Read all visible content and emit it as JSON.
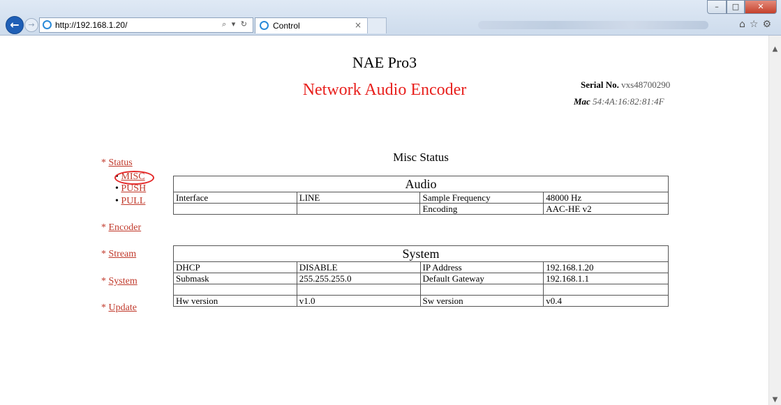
{
  "browser": {
    "url": "http://192.168.1.20/",
    "address_controls": "⌕ ▾ ↻",
    "tab_title": "Control",
    "tab_close": "×"
  },
  "header": {
    "title": "NAE Pro3",
    "subtitle": "Network Audio Encoder",
    "serial_label": "Serial No.",
    "serial_value": "vxs48700290",
    "mac_label": "Mac",
    "mac_value": "54:4A:16:82:81:4F"
  },
  "nav": {
    "status": "Status",
    "status_items": [
      "MISC",
      "PUSH",
      "PULL"
    ],
    "encoder": "Encoder",
    "stream": "Stream",
    "system": "System",
    "update": "Update"
  },
  "main": {
    "section_title": "Misc Status",
    "audio": {
      "title": "Audio",
      "rows": [
        [
          "Interface",
          "LINE",
          "Sample Frequency",
          "48000 Hz"
        ],
        [
          "",
          "",
          "Encoding",
          "AAC-HE v2"
        ]
      ]
    },
    "system": {
      "title": "System",
      "rows": [
        [
          "DHCP",
          "DISABLE",
          "IP Address",
          "192.168.1.20"
        ],
        [
          "Submask",
          "255.255.255.0",
          "Default Gateway",
          "192.168.1.1"
        ],
        [
          "",
          "",
          "",
          ""
        ],
        [
          "Hw version",
          "v1.0",
          "Sw version",
          "v0.4"
        ]
      ]
    }
  },
  "colors": {
    "accent_red": "#e8201d",
    "link_red": "#c0392b",
    "highlight_ring": "#e52b2b"
  }
}
